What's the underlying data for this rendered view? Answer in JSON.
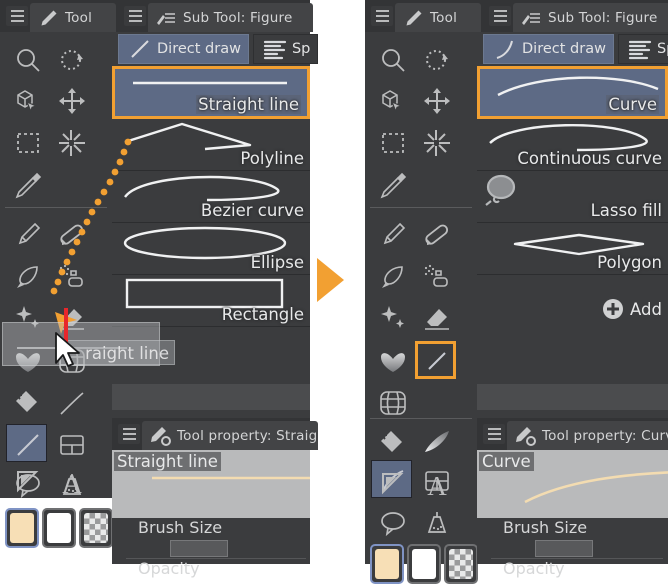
{
  "app": {
    "accent_orange": "#f2a032",
    "selected_blue": "#5d6a85",
    "panel_bg": "#3b3c3e",
    "titlebar_bg": "#333436",
    "text_color": "#e2e3e4"
  },
  "panels": {
    "left": {
      "tool_titlebar": {
        "title": "Tool",
        "icon": "pencil-icon",
        "menu_icon": "hamburger-icon"
      },
      "subtool_titlebar": {
        "title": "Sub Tool: Figure",
        "icon": "subtool-figure-icon",
        "menu_icon": "hamburger-icon"
      },
      "tool_icons": [
        "magnifier-icon",
        "rotate-icon",
        "object-select-icon",
        "move-icon",
        "marquee-select-icon",
        "auto-select-icon",
        "eyedropper-icon",
        "pen-icon",
        "pencil-tool-icon",
        "brush-icon",
        "airbrush-icon",
        "decoration-icon",
        "eraser-icon",
        "blend-icon",
        "gradient-icon",
        "fill-icon",
        "figure-icon",
        "frame-border-icon",
        "ruler-icon",
        "text-icon",
        "balloon-icon",
        "correct-line-icon"
      ],
      "selected_tool": "figure-icon",
      "swatches": [
        {
          "name": "main-color",
          "color": "#f7dfb6",
          "active": true
        },
        {
          "name": "sub-color",
          "color": "#ffffff",
          "active": false
        },
        {
          "name": "transparent-color",
          "color": "checker",
          "active": false
        }
      ],
      "subtool_tabs": [
        {
          "label": "Direct draw",
          "icon": "direct-draw-icon",
          "selected": true
        },
        {
          "label": "Sp",
          "icon": "speed-line-icon",
          "selected": false
        }
      ],
      "subtool_items": [
        {
          "label": "Straight line",
          "thumb": "straight-line-thumb",
          "selected": true
        },
        {
          "label": "Polyline",
          "thumb": "polyline-thumb",
          "selected": false
        },
        {
          "label": "Bezier curve",
          "thumb": "bezier-curve-thumb",
          "selected": false
        },
        {
          "label": "Ellipse",
          "thumb": "ellipse-thumb",
          "selected": false
        },
        {
          "label": "Rectangle",
          "thumb": "rectangle-thumb",
          "selected": false
        }
      ],
      "tool_property": {
        "title": "Tool property: Straig",
        "icon": "toolproperty-icon",
        "preset_name": "Straight line",
        "rows": [
          {
            "label": "Brush Size",
            "control": "slider"
          },
          {
            "label": "Opacity",
            "control": "slider"
          }
        ]
      },
      "drag": {
        "ghost_label": "raight line",
        "drop_indicator": "red-insert-bar",
        "cursor": "arrow-cursor",
        "path": "orange-dotted-drag-path",
        "path_arrow": "orange-arrowhead"
      }
    },
    "right": {
      "tool_titlebar": {
        "title": "Tool",
        "icon": "pencil-icon",
        "menu_icon": "hamburger-icon"
      },
      "subtool_titlebar": {
        "title": "Sub Tool: Figure",
        "icon": "subtool-figure-icon",
        "menu_icon": "hamburger-icon"
      },
      "tool_icons": [
        "magnifier-icon",
        "rotate-icon",
        "object-select-icon",
        "move-icon",
        "marquee-select-icon",
        "auto-select-icon",
        "eyedropper-icon",
        "pen-icon",
        "pencil-tool-icon",
        "brush-icon",
        "airbrush-icon",
        "decoration-icon",
        "eraser-icon",
        "blend-icon",
        "figure-icon",
        "gradient-icon",
        "fill-icon",
        "curve-icon",
        "frame-border-icon",
        "ruler-icon",
        "text-icon",
        "balloon-icon",
        "correct-line-icon"
      ],
      "selected_tool": "curve-icon",
      "highlighted_tool": "figure-icon",
      "swatches": [
        {
          "name": "main-color",
          "color": "#f7dfb6",
          "active": true
        },
        {
          "name": "sub-color",
          "color": "#ffffff",
          "active": false
        },
        {
          "name": "transparent-color",
          "color": "checker",
          "active": false
        }
      ],
      "subtool_tabs": [
        {
          "label": "Direct draw",
          "icon": "direct-draw-curve-icon",
          "selected": true
        },
        {
          "label": "Sp",
          "icon": "speed-line-icon",
          "selected": false
        }
      ],
      "subtool_items": [
        {
          "label": "Curve",
          "thumb": "curve-thumb",
          "selected": true
        },
        {
          "label": "Continuous curve",
          "thumb": "continuous-curve-thumb",
          "selected": false
        },
        {
          "label": "Lasso fill",
          "thumb": "lasso-fill-thumb",
          "selected": false
        },
        {
          "label": "Polygon",
          "thumb": "polygon-thumb",
          "selected": false
        }
      ],
      "add_row": {
        "label": "Add",
        "icon": "plus-circle-icon"
      },
      "tool_property": {
        "title": "Tool property: Curv",
        "icon": "toolproperty-icon",
        "preset_name": "Curve",
        "rows": [
          {
            "label": "Brush Size",
            "control": "slider"
          },
          {
            "label": "Opacity",
            "control": "slider"
          }
        ]
      }
    }
  },
  "transition_arrow": {
    "name": "step-arrow",
    "color": "#f2a032"
  }
}
